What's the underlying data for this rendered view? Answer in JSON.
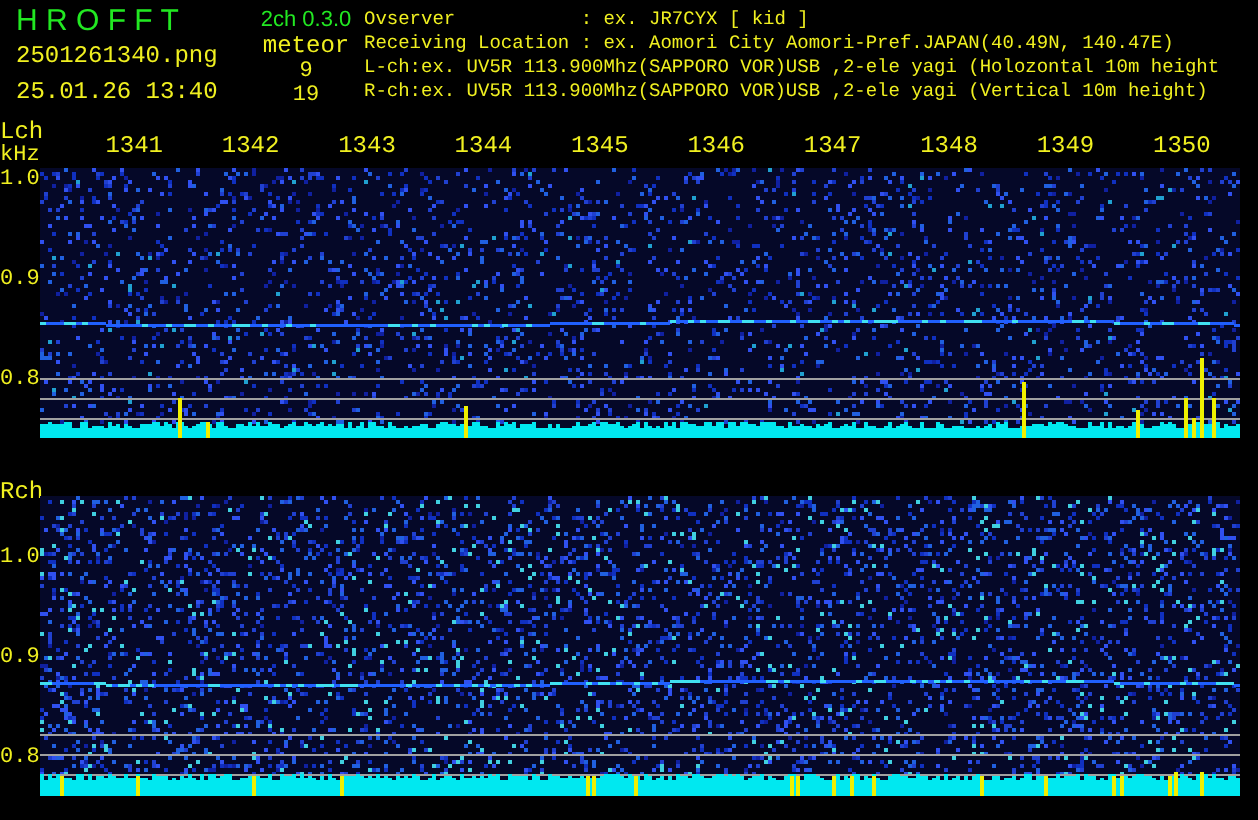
{
  "app": {
    "title": "H R O F F T",
    "version": "2ch 0.3.0"
  },
  "file": {
    "name": "2501261340.png",
    "datetime": "25.01.26 13:40"
  },
  "meteor": {
    "label": "meteor",
    "counts": [
      "9",
      "19"
    ]
  },
  "info": [
    {
      "kind": "field",
      "label": "Ovserver",
      "value": ": ex. JR7CYX [ kid ]"
    },
    {
      "kind": "field",
      "label": "Receiving Location",
      "value": ": ex. Aomori City Aomori-Pref.JAPAN(40.49N, 140.47E)"
    },
    {
      "kind": "line",
      "text": "L-ch:ex. UV5R 113.900Mhz(SAPPORO VOR)USB ,2-ele yagi (Holozontal 10m height"
    },
    {
      "kind": "line",
      "text": "R-ch:ex. UV5R 113.900Mhz(SAPPORO VOR)USB ,2-ele yagi (Vertical 10m height)"
    }
  ],
  "channels": [
    {
      "name": "Lch",
      "unit": "kHz",
      "time_ticks": [
        "1341",
        "1342",
        "1343",
        "1344",
        "1345",
        "1346",
        "1347",
        "1348",
        "1349",
        "1350"
      ],
      "freq_ticks": [
        "1.0",
        "0.9",
        "0.8"
      ]
    },
    {
      "name": "Rch",
      "freq_ticks": [
        "1.0",
        "0.9",
        "0.8"
      ]
    }
  ]
}
